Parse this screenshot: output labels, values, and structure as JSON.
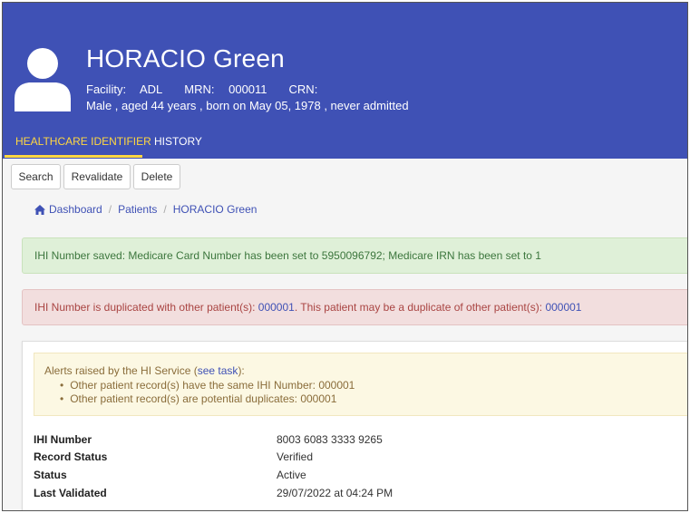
{
  "patient": {
    "name": "HORACIO Green",
    "facility_label": "Facility:",
    "facility": "ADL",
    "mrn_label": "MRN:",
    "mrn": "000011",
    "crn_label": "CRN:",
    "summary": "Male , aged 44 years , born on May 05, 1978 , never admitted"
  },
  "tabs": [
    {
      "label": "HEALTHCARE IDENTIFIER",
      "active": true
    },
    {
      "label": "HISTORY",
      "active": false
    }
  ],
  "toolbar": {
    "search_label": "Search",
    "revalidate_label": "Revalidate",
    "delete_label": "Delete"
  },
  "breadcrumb": {
    "icon": "home-icon",
    "items": [
      "Dashboard",
      "Patients",
      "HORACIO Green"
    ],
    "separator": "/"
  },
  "alerts": {
    "success": "IHI Number saved: Medicare Card Number has been set to 5950096792; Medicare IRN has been set to 1",
    "danger_prefix": "IHI Number is duplicated with other patient(s): ",
    "danger_link_1": "000001",
    "danger_middle": ". This patient may be a duplicate of other patient(s): ",
    "danger_link_2": "000001"
  },
  "hi_service": {
    "intro_prefix": "Alerts raised by the HI Service (",
    "intro_link": "see task",
    "intro_suffix": "):",
    "items": [
      "Other patient record(s) have the same IHI Number: 000001",
      "Other patient record(s) are potential duplicates: 000001"
    ]
  },
  "details": [
    {
      "label": "IHI Number",
      "value": "8003 6083 3333 9265"
    },
    {
      "label": "Record Status",
      "value": "Verified"
    },
    {
      "label": "Status",
      "value": "Active"
    },
    {
      "label": "Last Validated",
      "value": "29/07/2022 at 04:24 PM"
    }
  ],
  "colors": {
    "header": "#3f51b5",
    "active_tab": "#ffd740",
    "success_bg": "#dff0d8",
    "danger_bg": "#f2dede",
    "warning_bg": "#fcf8e3"
  }
}
